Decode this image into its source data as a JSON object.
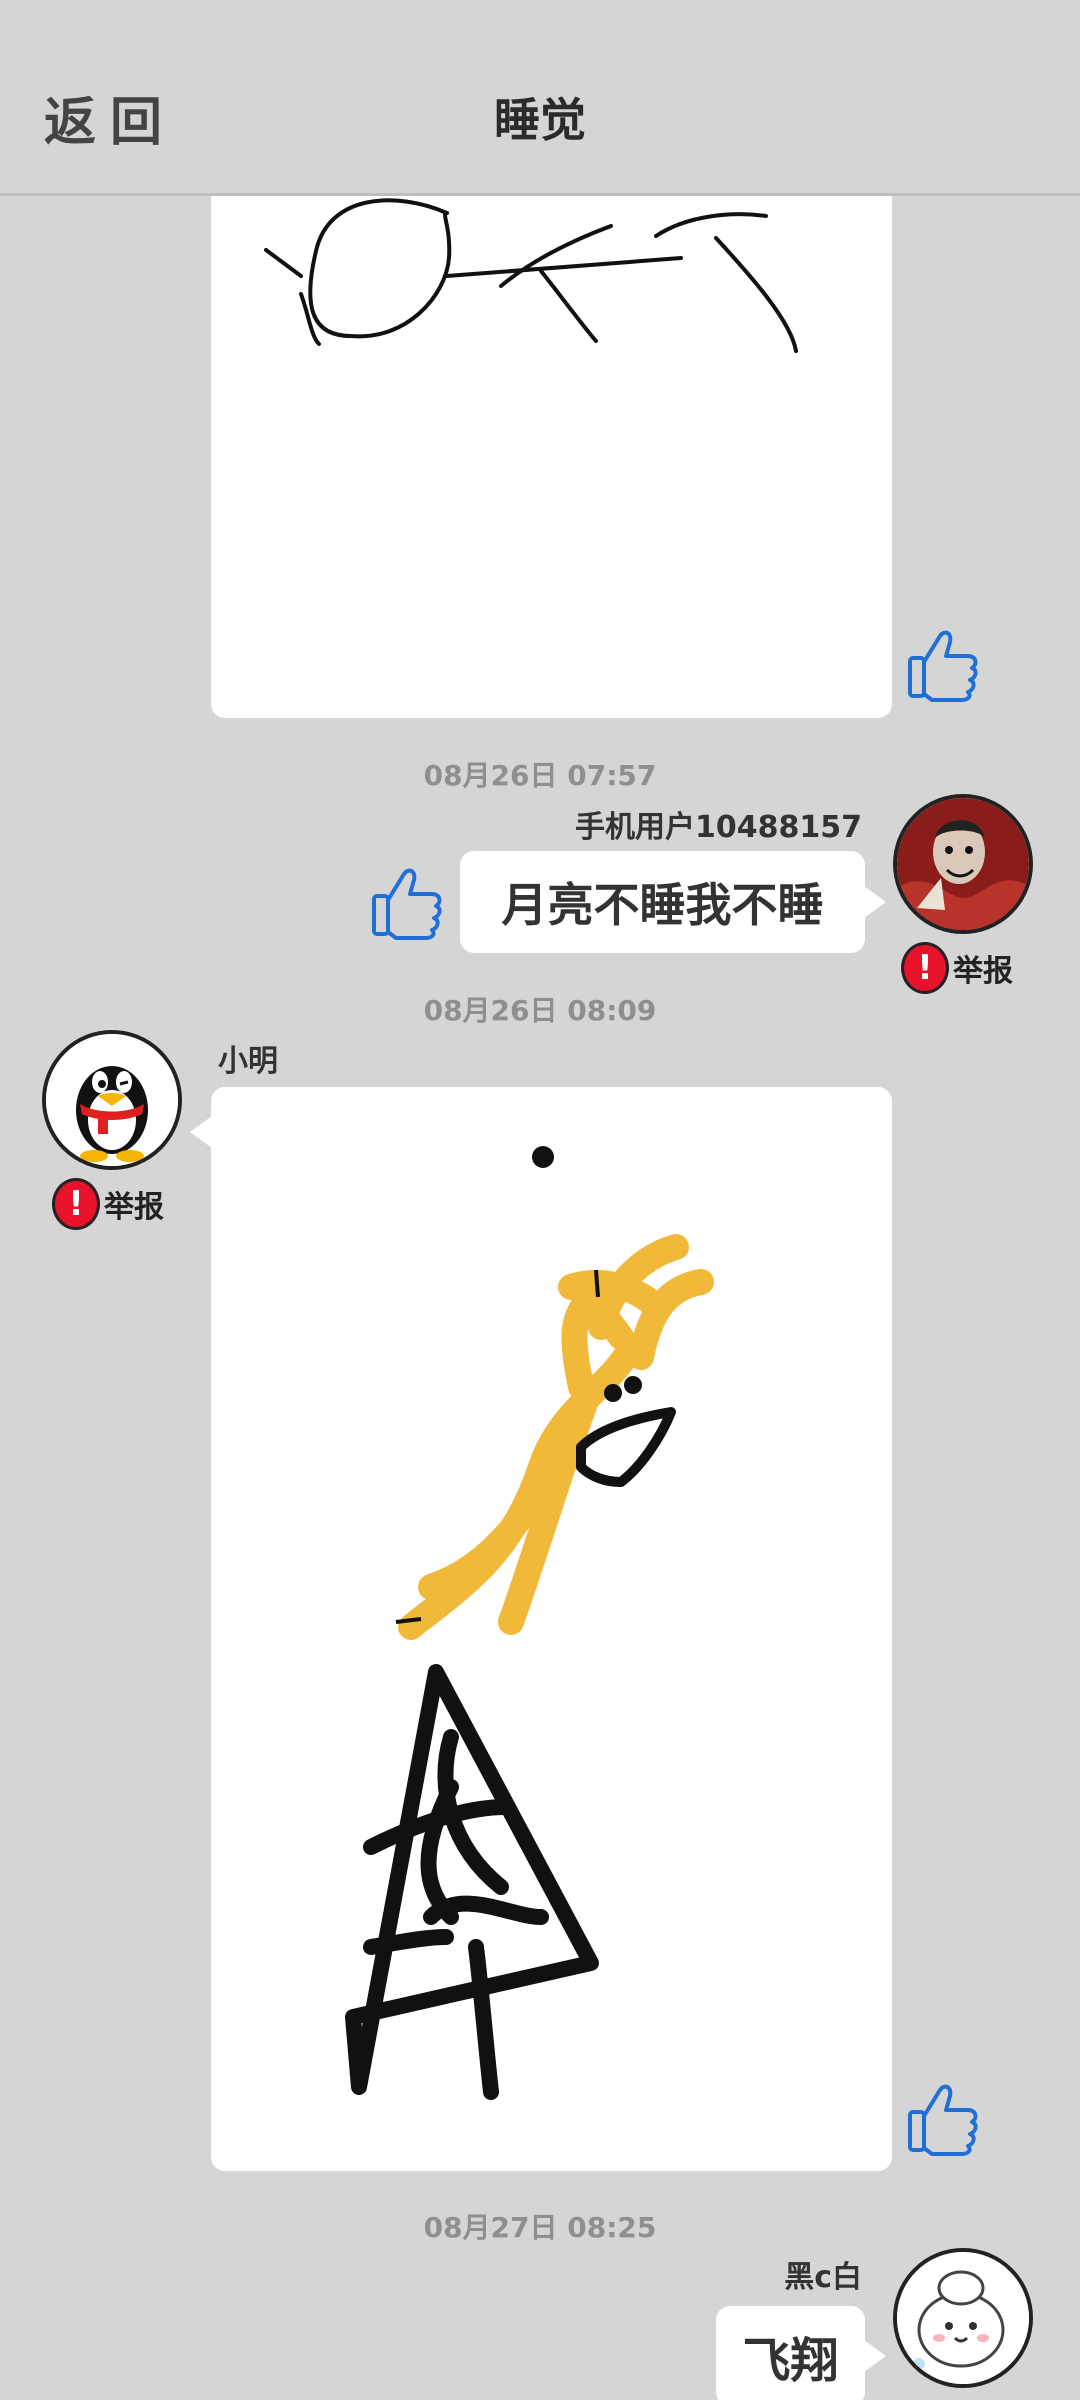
{
  "header": {
    "back_label": "返回",
    "title": "睡觉"
  },
  "report_label": "举报",
  "messages": [
    {
      "time": "08月26日  07:57",
      "sender": "手机用户10488157",
      "text": "月亮不睡我不睡"
    },
    {
      "time": "08月26日  08:09",
      "sender": "小明"
    },
    {
      "time": "08月27日  08:25",
      "sender": "黑c白",
      "text": "飞翔"
    }
  ],
  "icons": {
    "like": "thumbs-up-icon",
    "report": "exclamation-icon",
    "back": "back-text"
  },
  "colors": {
    "background": "#d5d5d5",
    "like": "#1f6fd6",
    "report": "#e8122a",
    "drawing_yellow": "#f0b93a"
  }
}
